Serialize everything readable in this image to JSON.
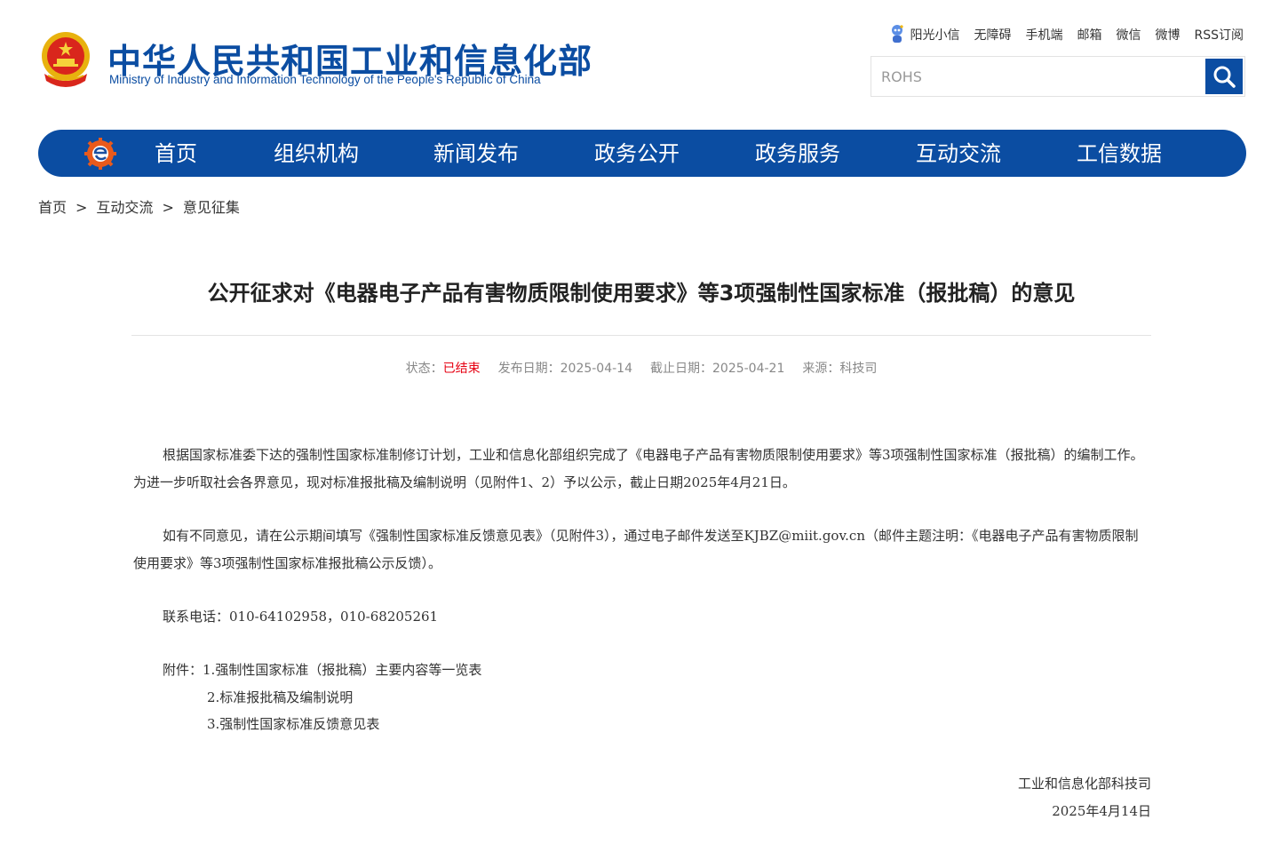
{
  "header": {
    "title_cn": "中华人民共和国工业和信息化部",
    "title_en": "Ministry of Industry and Information Technology of the People's Republic of China",
    "emblem_icon": "national-emblem-icon",
    "top_links": [
      "阳光小信",
      "无障碍",
      "手机端",
      "邮箱",
      "微信",
      "微博",
      "RSS订阅"
    ],
    "search": {
      "value": "",
      "placeholder": "ROHS"
    }
  },
  "nav": {
    "logo_icon": "miit-logo-icon",
    "items": [
      "首页",
      "组织机构",
      "新闻发布",
      "政务公开",
      "政务服务",
      "互动交流",
      "工信数据"
    ]
  },
  "breadcrumb": [
    "首页",
    "互动交流",
    "意见征集"
  ],
  "article": {
    "title": "公开征求对《电器电子产品有害物质限制使用要求》等3项强制性国家标准（报批稿）的意见",
    "meta": {
      "status_label": "状态：",
      "status_value": "已结束",
      "publish": "发布日期：2025-04-14",
      "deadline": "截止日期：2025-04-21",
      "source": "来源：科技司"
    },
    "paragraphs": [
      "根据国家标准委下达的强制性国家标准制修订计划，工业和信息化部组织完成了《电器电子产品有害物质限制使用要求》等3项强制性国家标准（报批稿）的编制工作。为进一步听取社会各界意见，现对标准报批稿及编制说明（见附件1、2）予以公示，截止日期2025年4月21日。",
      "如有不同意见，请在公示期间填写《强制性国家标准反馈意见表》（见附件3），通过电子邮件发送至KJBZ@miit.gov.cn（邮件主题注明：《电器电子产品有害物质限制使用要求》等3项强制性国家标准报批稿公示反馈）。",
      "联系电话：010-64102958，010-68205261"
    ],
    "attachments_label": "附件：",
    "attachments": [
      "1.强制性国家标准（报批稿）主要内容等一览表",
      "2.标准报批稿及编制说明",
      "3.强制性国家标准反馈意见表"
    ],
    "signature": {
      "org": "工业和信息化部科技司",
      "date": "2025年4月14日"
    }
  },
  "colors": {
    "brand_blue": "#0b4da2",
    "status_red": "#e60012"
  }
}
